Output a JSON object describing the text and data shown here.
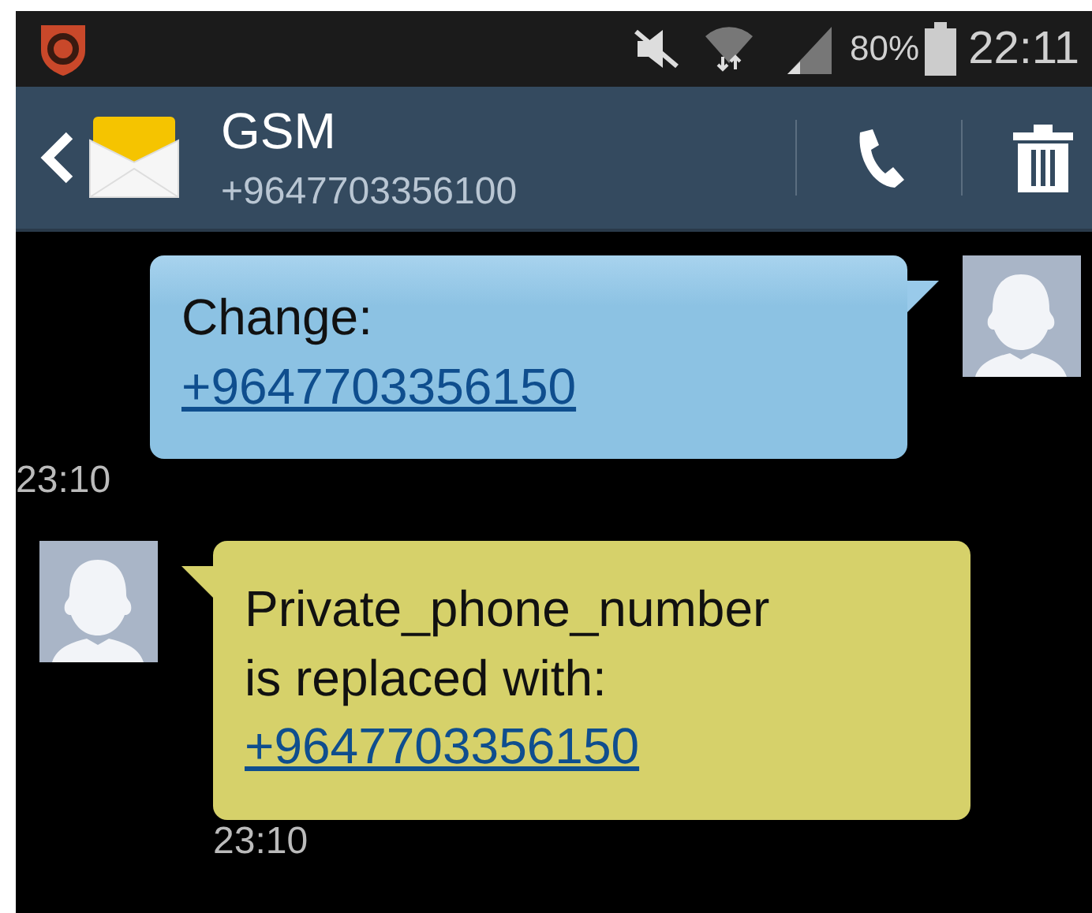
{
  "status_bar": {
    "battery": "80%",
    "time": "22:11"
  },
  "header": {
    "title": "GSM",
    "subtitle": "+9647703356100"
  },
  "messages": [
    {
      "kind": "sent",
      "text": "Change:",
      "link": "+9647703356150",
      "time": "23:10"
    },
    {
      "kind": "received",
      "text": "Private_phone_number is replaced with:",
      "link": "+9647703356150",
      "time": "23:10"
    }
  ]
}
